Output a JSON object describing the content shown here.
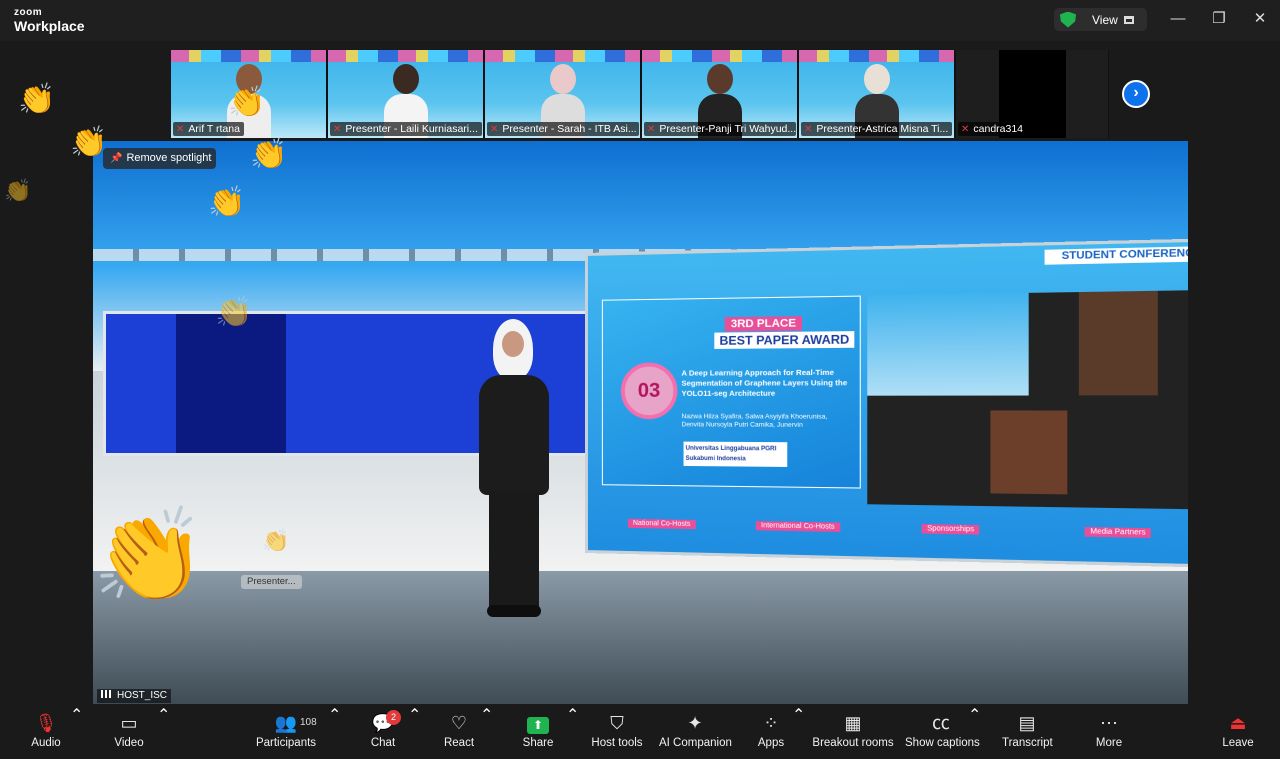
{
  "app": {
    "brand_small": "zoom",
    "brand_large": "Workplace"
  },
  "titlebar": {
    "view_label": "View",
    "controls": [
      "minimize",
      "restore",
      "close"
    ]
  },
  "participants_strip": [
    {
      "name": "Arif T rtana"
    },
    {
      "name": "Presenter - Laili Kurniasari..."
    },
    {
      "name": "Presenter - Sarah - ITB Asi..."
    },
    {
      "name": "Presenter-Panji Tri Wahyud..."
    },
    {
      "name": "Presenter-Astrica Misna Ti..."
    },
    {
      "name": "candra314"
    }
  ],
  "spotlight": {
    "remove_label": "Remove spotlight"
  },
  "stage": {
    "presenter_tag": "Presenter...",
    "host_label": "HOST_ISC",
    "screen": {
      "conference_bar": "STUDENT CONFERENCE",
      "place": "3RD PLACE",
      "award": "BEST PAPER AWARD",
      "medal_number": "03",
      "paper_title": "A Deep Learning Approach for Real-Time Segmentation of Graphene Layers Using the YOLO11-seg Architecture",
      "authors": "Nazwa Hilza Syafira, Salwa Asyiyifa Khoerunisa, Denvita Nursoyla Putri Camika, Junervin",
      "university": "Universitas Linggabuana PGRI Sukabumi Indonesia",
      "cohost_labels": [
        "National Co-Hosts",
        "International Co-Hosts",
        "Sponsorships",
        "Media Partners"
      ]
    }
  },
  "toolbar": {
    "audio": "Audio",
    "video": "Video",
    "participants": "Participants",
    "participants_count": "108",
    "chat": "Chat",
    "chat_badge": "2",
    "react": "React",
    "share": "Share",
    "host_tools": "Host tools",
    "ai_companion": "AI Companion",
    "apps": "Apps",
    "breakout_rooms": "Breakout rooms",
    "show_captions": "Show captions",
    "transcript": "Transcript",
    "more": "More",
    "leave": "Leave"
  },
  "colors": {
    "accent": "#0e72ed",
    "share_green": "#20b451",
    "leave_red": "#e33333",
    "badge_red": "#e23a3a"
  }
}
